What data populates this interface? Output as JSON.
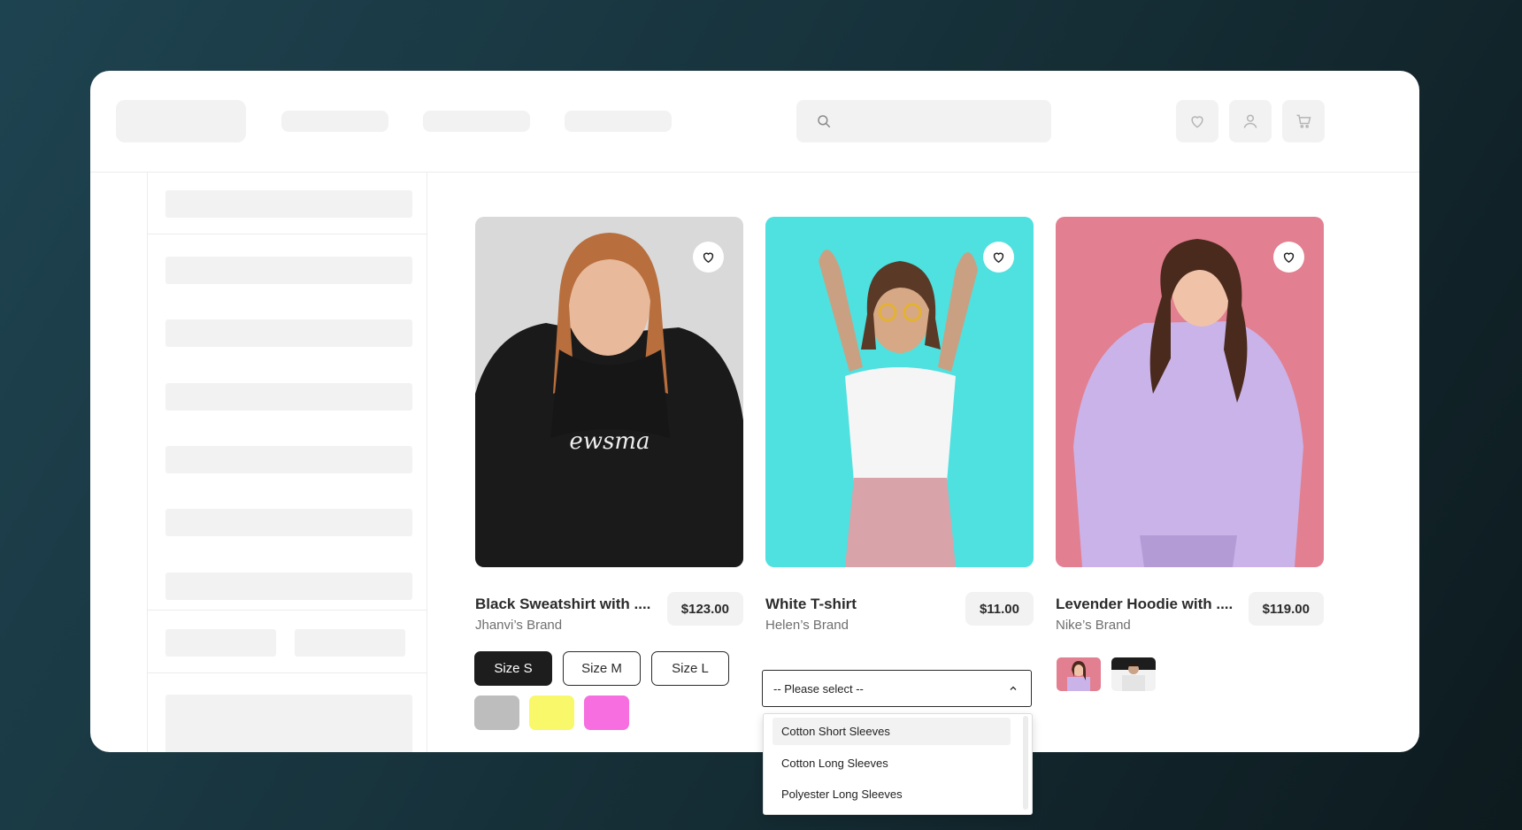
{
  "header": {
    "search_placeholder": "",
    "icons": [
      "search-icon",
      "heart-icon",
      "user-icon",
      "cart-icon"
    ]
  },
  "products": [
    {
      "title": "Black Sweatshirt with ....",
      "brand": "Jhanvi’s  Brand",
      "price": "$123.00",
      "image_bg": "#d9d9d9",
      "sizes": [
        {
          "label": "Size S",
          "selected": true
        },
        {
          "label": "Size M",
          "selected": false
        },
        {
          "label": "Size L",
          "selected": false
        }
      ],
      "colors": [
        "#bdbdbd",
        "#f8f86a",
        "#f76ee0"
      ]
    },
    {
      "title": "White T-shirt",
      "brand": "Helen’s  Brand",
      "price": "$11.00",
      "image_bg": "#4fe0e0",
      "select": {
        "value": "-- Please select --",
        "options": [
          "Cotton Short Sleeves",
          "Cotton Long Sleeves",
          "Polyester Long Sleeves"
        ],
        "highlighted": "Cotton Short Sleeves"
      }
    },
    {
      "title": "Levender Hoodie with ....",
      "brand": "Nike’s  Brand",
      "price": "$119.00",
      "image_bg": "#e27f91"
    }
  ],
  "colors": {
    "background": "#1e4350",
    "skeleton": "#f2f2f2",
    "dark_button": "#1d1d1d"
  }
}
